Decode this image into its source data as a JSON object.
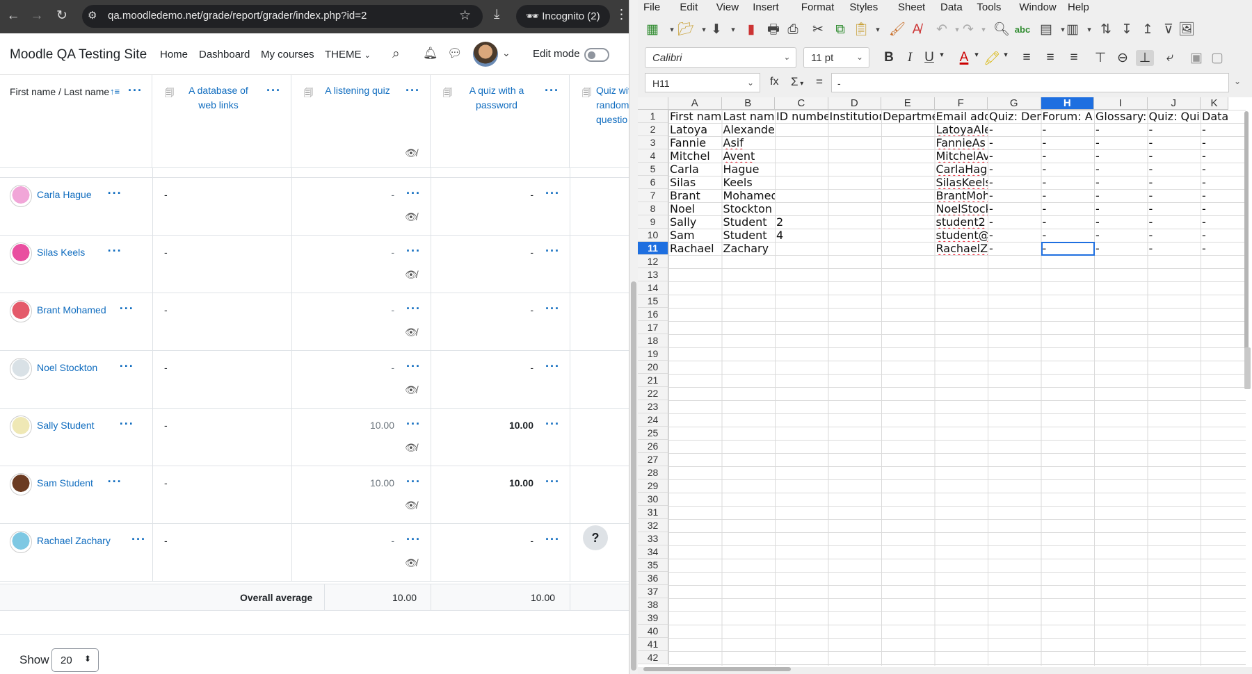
{
  "browser": {
    "url": "qa.moodledemo.net/grade/report/grader/index.php?id=2",
    "incognito_label": "Incognito (2)"
  },
  "moodle": {
    "site_name": "Moodle QA Testing Site",
    "nav": [
      "Home",
      "Dashboard",
      "My courses",
      "THEME"
    ],
    "edit_mode_label": "Edit mode",
    "grader": {
      "name_header": "First name / Last name",
      "columns": [
        {
          "title_lines": [
            "A database of",
            "web links"
          ]
        },
        {
          "title_lines": [
            "A listening quiz"
          ]
        },
        {
          "title_lines": [
            "A quiz with a",
            "password"
          ]
        },
        {
          "title_lines": [
            "Quiz wit",
            "random",
            "questio"
          ]
        }
      ],
      "rows": [
        {
          "name": "Carla Hague",
          "c1": "-",
          "c2": "-",
          "c3": "-"
        },
        {
          "name": "Silas Keels",
          "c1": "-",
          "c2": "-",
          "c3": "-"
        },
        {
          "name": "Brant Mohamed",
          "c1": "-",
          "c2": "-",
          "c3": "-"
        },
        {
          "name": "Noel Stockton",
          "c1": "-",
          "c2": "-",
          "c3": "-"
        },
        {
          "name": "Sally Student",
          "c1": "-",
          "c2": "10.00",
          "c3": "10.00"
        },
        {
          "name": "Sam Student",
          "c1": "-",
          "c2": "10.00",
          "c3": "10.00"
        },
        {
          "name": "Rachael Zachary",
          "c1": "-",
          "c2": "-",
          "c3": "-"
        }
      ],
      "overall_label": "Overall average",
      "overall_c2": "10.00",
      "overall_c3": "10.00",
      "help_label": "?",
      "show_label": "Show",
      "show_value": "20"
    }
  },
  "calc": {
    "menus": [
      "File",
      "Edit",
      "View",
      "Insert",
      "Format",
      "Styles",
      "Sheet",
      "Data",
      "Tools",
      "Window",
      "Help"
    ],
    "font_name": "Calibri",
    "font_size": "11 pt",
    "name_box": "H11",
    "fx_label": "fx",
    "formula": "-",
    "columns": [
      "A",
      "B",
      "C",
      "D",
      "E",
      "F",
      "G",
      "H",
      "I",
      "J",
      "K"
    ],
    "selected_col": "H",
    "selected_row": 11,
    "header_row": [
      "First nam",
      "Last nam",
      "ID numbe",
      "Institution",
      "Departme",
      "Email add",
      "Quiz: Den",
      "Forum: A",
      "Glossary:",
      "Quiz: Qui",
      "Datab"
    ],
    "data_rows": [
      [
        "Latoya",
        "Alexander",
        "",
        "",
        "",
        "LatoyaAle",
        "-",
        "-",
        "-",
        "-",
        "-"
      ],
      [
        "Fannie",
        "Asif",
        "",
        "",
        "",
        "FannieAs",
        "-",
        "-",
        "-",
        "-",
        "-"
      ],
      [
        "Mitchel",
        "Avent",
        "",
        "",
        "",
        "MitchelAv",
        "-",
        "-",
        "-",
        "-",
        "-"
      ],
      [
        "Carla",
        "Hague",
        "",
        "",
        "",
        "CarlaHag",
        "-",
        "-",
        "-",
        "-",
        "-"
      ],
      [
        "Silas",
        "Keels",
        "",
        "",
        "",
        "SilasKeels",
        "-",
        "-",
        "-",
        "-",
        "-"
      ],
      [
        "Brant",
        "Mohamed",
        "",
        "",
        "",
        "BrantMoh",
        "-",
        "-",
        "-",
        "-",
        "-"
      ],
      [
        "Noel",
        "Stockton",
        "",
        "",
        "",
        "NoelStock",
        "-",
        "-",
        "-",
        "-",
        "-"
      ],
      [
        "Sally",
        "Student",
        "2",
        "",
        "",
        "student2",
        "-",
        "-",
        "-",
        "-",
        "-"
      ],
      [
        "Sam",
        "Student",
        "4",
        "",
        "",
        "student@",
        "-",
        "-",
        "-",
        "-",
        "-"
      ],
      [
        "Rachael",
        "Zachary",
        "",
        "",
        "",
        "RachaelZ",
        "-",
        "-",
        "-",
        "-",
        "-"
      ]
    ],
    "row_numbers": [
      1,
      2,
      3,
      4,
      5,
      6,
      7,
      8,
      9,
      10,
      11,
      12,
      13,
      14,
      15,
      16,
      17,
      18,
      19,
      20,
      21,
      22,
      23,
      24,
      25,
      26,
      27,
      28,
      29,
      30,
      31,
      32,
      33,
      34,
      35,
      36,
      37,
      38,
      39,
      40,
      41,
      42
    ]
  }
}
